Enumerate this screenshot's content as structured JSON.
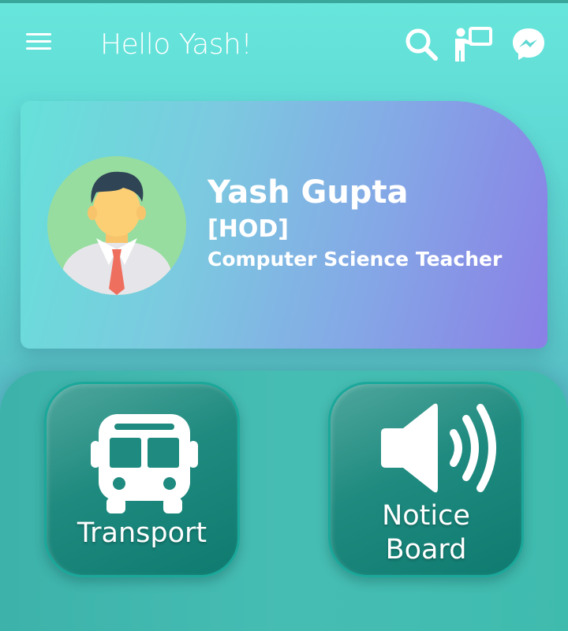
{
  "header": {
    "greeting": "Hello Yash!",
    "icons": [
      "menu-icon",
      "search-icon",
      "teacher-board-icon",
      "messenger-icon"
    ]
  },
  "profile": {
    "name": "Yash Gupta",
    "role": "[HOD]",
    "department": "Computer Science Teacher",
    "avatar_icon": "male-teacher-avatar"
  },
  "tiles": [
    {
      "label": "Transport",
      "icon": "bus-icon"
    },
    {
      "label": "Notice\nBoard",
      "icon": "speaker-icon"
    }
  ],
  "colors": {
    "background_top": "#67e6dc",
    "card_gradient_end": "#8a7fe6",
    "tile_teal": "#1f8a7f"
  }
}
